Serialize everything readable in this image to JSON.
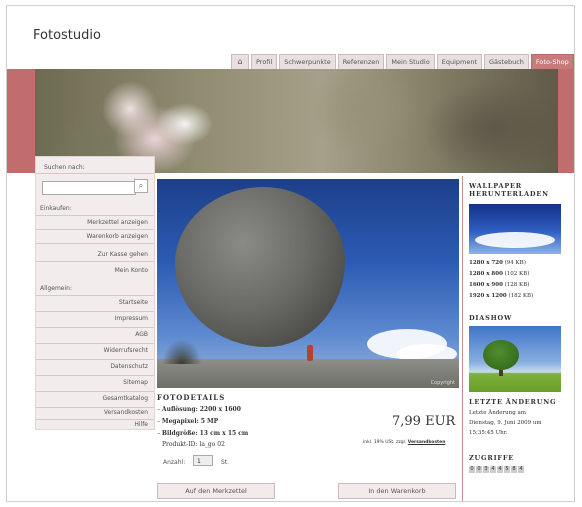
{
  "site": {
    "title": "Fotostudio"
  },
  "nav": {
    "home_icon": "home-icon",
    "items": [
      "Profil",
      "Schwerpunkte",
      "Referenzen",
      "Mein Studio",
      "Equipment",
      "Gästebuch",
      "Foto-Shop"
    ],
    "active": "Foto-Shop"
  },
  "colors": {
    "accent": "#c26d6d",
    "accent_light": "#f2ecec"
  },
  "sidebar": {
    "search_label": "Suchen nach:",
    "search_value": "",
    "search_icon": "search-icon",
    "einkaufen_label": "Einkaufen:",
    "einkaufen_links": [
      "Merkzettel anzeigen",
      "Warenkorb anzeigen",
      "Zur Kasse gehen",
      "Mein Konto"
    ],
    "allgemein_label": "Allgemein:",
    "allgemein_links": [
      "Startseite",
      "Impressum",
      "AGB",
      "Widerrufsrecht",
      "Datenschutz",
      "Sitemap",
      "Gesamtkatalog",
      "Versandkosten",
      "Hilfe"
    ]
  },
  "product": {
    "copyright": "Copyright",
    "details_title": "FOTODETAILS",
    "specs": [
      {
        "label": "Auflösung:",
        "value": "2200 x 1600"
      },
      {
        "label": "Megapixel:",
        "value": "5 MP"
      },
      {
        "label": "Bildgröße:",
        "value": "13 cm x 15 cm"
      }
    ],
    "product_id": "Produkt-ID: la_go 02",
    "price": "7,99 EUR",
    "tax_note": "inkl. 19% USt. zzgl.",
    "shipping_link": "Versandkosten",
    "quantity_label": "Anzahl:",
    "quantity_value": "1",
    "quantity_unit": "St.",
    "btn_wishlist": "Auf den Merkzettel",
    "btn_cart": "In den Warenkorb"
  },
  "right": {
    "wallpaper_title_1": "WALLPAPER",
    "wallpaper_title_2": "HERUNTERLADEN",
    "wallpaper_sizes": [
      {
        "res": "1280 x 720",
        "size": "(94 KB)"
      },
      {
        "res": "1280 x 800",
        "size": "(102 KB)"
      },
      {
        "res": "1600 x 900",
        "size": "(128 KB)"
      },
      {
        "res": "1920 x 1200",
        "size": "(182 KB)"
      }
    ],
    "slideshow_title": "DIASHOW",
    "last_change_title": "LETZTE ÄNDERUNG",
    "last_change_text_1": "Letzte Änderung am",
    "last_change_text_2": "Dienstag, 9. Juni 2009 um",
    "last_change_text_3": "15:35:45 Uhr.",
    "hits_title": "ZUGRIFFE",
    "hits_digits": [
      "0",
      "0",
      "3",
      "4",
      "4",
      "5",
      "8",
      "4"
    ]
  }
}
